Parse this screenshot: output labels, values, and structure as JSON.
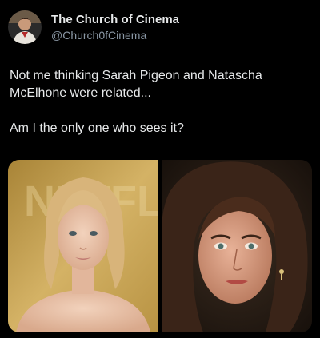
{
  "tweet": {
    "author": {
      "display_name": "The Church of Cinema",
      "handle": "@Church0fCinema",
      "avatar_icon": "profile-avatar"
    },
    "text": {
      "paragraph_1": "Not me thinking Sarah Pigeon and Natascha McElhone were related...",
      "paragraph_2": "Am I the only one who sees it?"
    },
    "media": {
      "photo_left_backdrop_text": "NETFLIX",
      "photo_left_colors": {
        "backdrop": "#c9a64f",
        "hair": "#d9b57a",
        "skin": "#e8c2a8"
      },
      "photo_right_colors": {
        "backdrop": "#2a2018",
        "hair": "#3a2418",
        "skin": "#d99a7c"
      }
    }
  }
}
